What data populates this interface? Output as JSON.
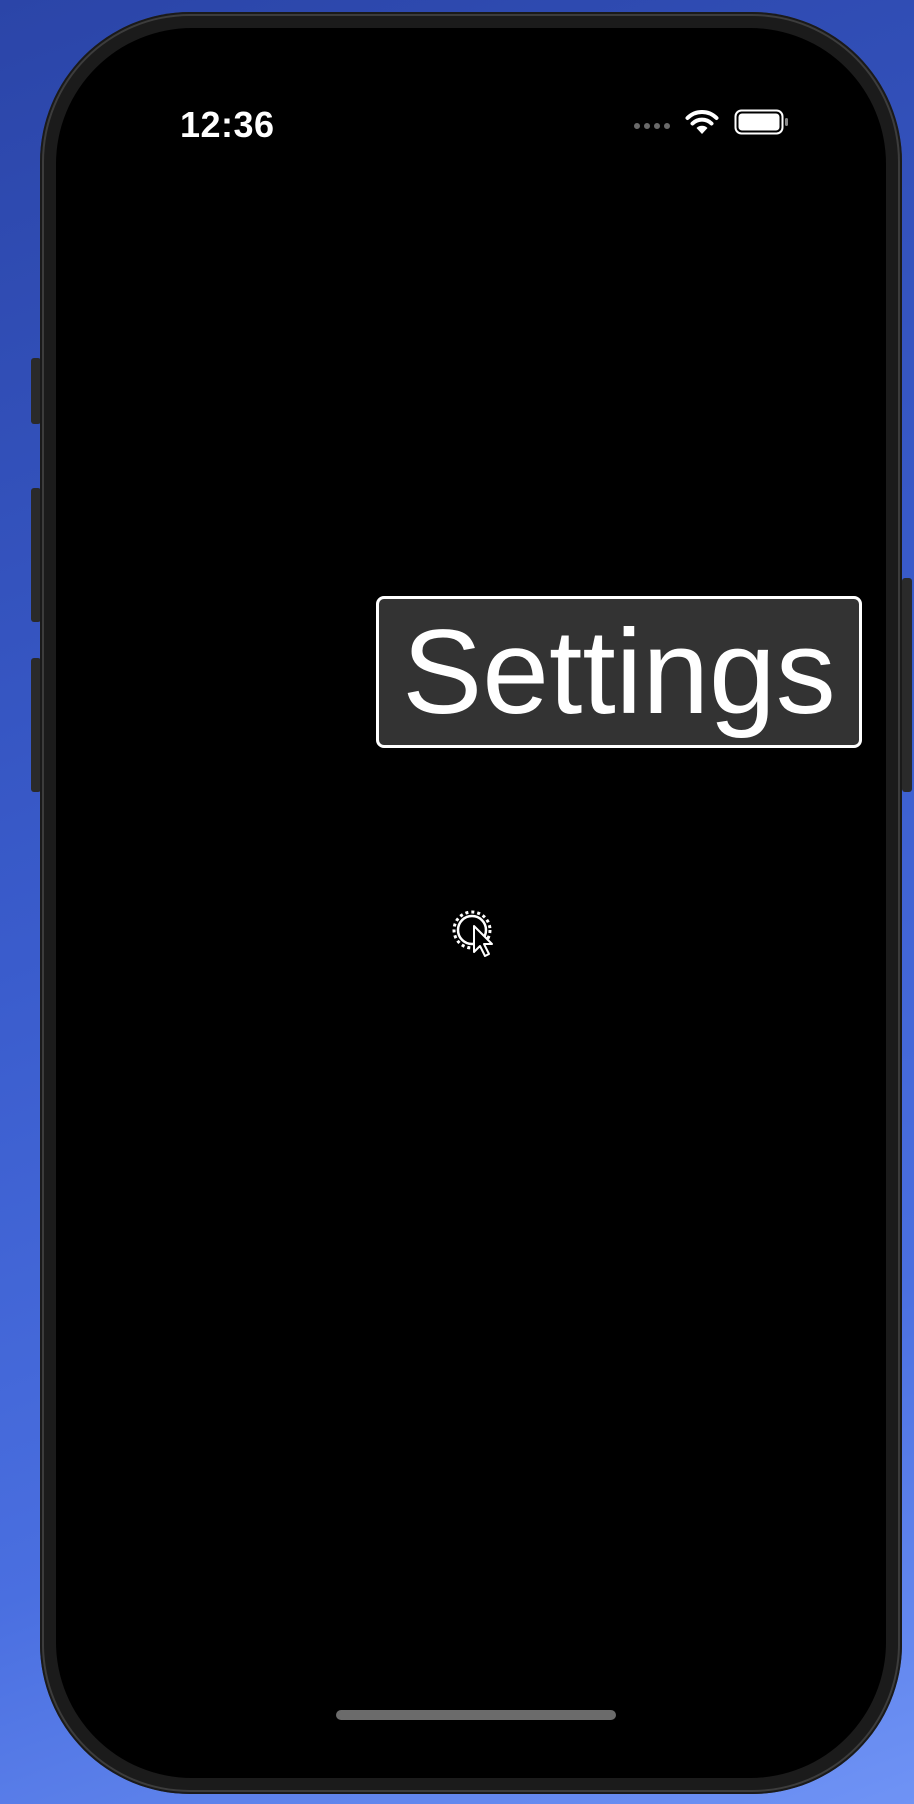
{
  "status_bar": {
    "time": "12:36",
    "icons": [
      "signal-dots-icon",
      "wifi-icon",
      "battery-icon"
    ]
  },
  "main": {
    "settings_label": "Settings"
  },
  "cursor": {
    "icon": "busy-gear-cursor-icon"
  },
  "colors": {
    "screen_background": "#000000",
    "button_background": "#333333",
    "button_border": "#ffffff",
    "text": "#ffffff"
  }
}
